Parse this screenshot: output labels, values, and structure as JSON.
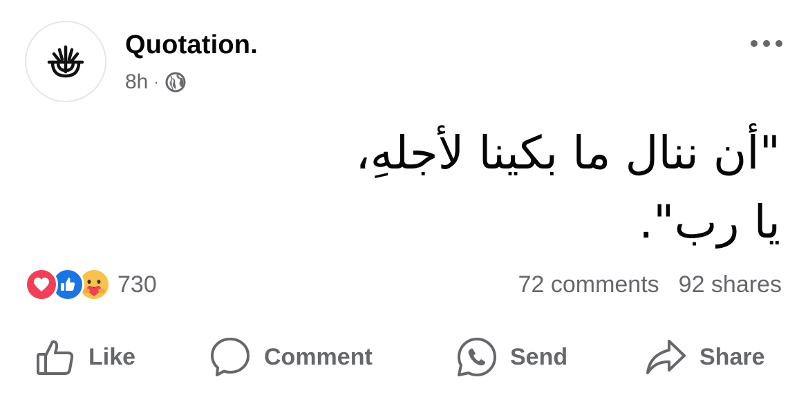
{
  "post": {
    "author": "Quotation.",
    "time": "8h",
    "separator": "·",
    "audience_icon": "globe-icon",
    "avatar_icon": "plant-logo-icon",
    "more_icon": "more-horizontal-icon",
    "text_lines": [
      "\"أن ننال ما بكينا لأجلهِ،",
      "يا رب\"."
    ]
  },
  "stats": {
    "reactions": [
      "love-reaction-icon",
      "like-reaction-icon",
      "care-reaction-icon"
    ],
    "reaction_count": "730",
    "comments": "72 comments",
    "shares": "92 shares"
  },
  "actions": {
    "like": "Like",
    "comment": "Comment",
    "send": "Send",
    "share": "Share"
  },
  "colors": {
    "text_primary": "#050505",
    "text_secondary": "#65676b",
    "love": "#f33e58",
    "like": "#1b74e4",
    "care": "#f7c34a"
  }
}
